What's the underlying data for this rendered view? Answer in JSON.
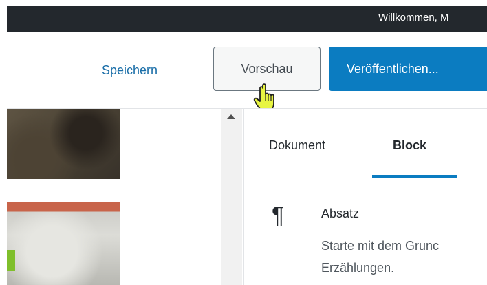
{
  "admin_bar": {
    "greeting": "Willkommen, M"
  },
  "header": {
    "save_label": "Speichern",
    "preview_label": "Vorschau",
    "publish_label": "Veröffentlichen..."
  },
  "sidebar": {
    "tabs": [
      {
        "label": "Dokument",
        "active": false
      },
      {
        "label": "Block",
        "active": true
      }
    ],
    "block": {
      "icon": "paragraph-icon",
      "title": "Absatz",
      "description_line1": "Starte mit dem Grunc",
      "description_line2": "Erzählungen."
    }
  },
  "colors": {
    "accent": "#0b7cc1",
    "admin_bar": "#23282d",
    "cursor_fill": "#e8f542"
  }
}
